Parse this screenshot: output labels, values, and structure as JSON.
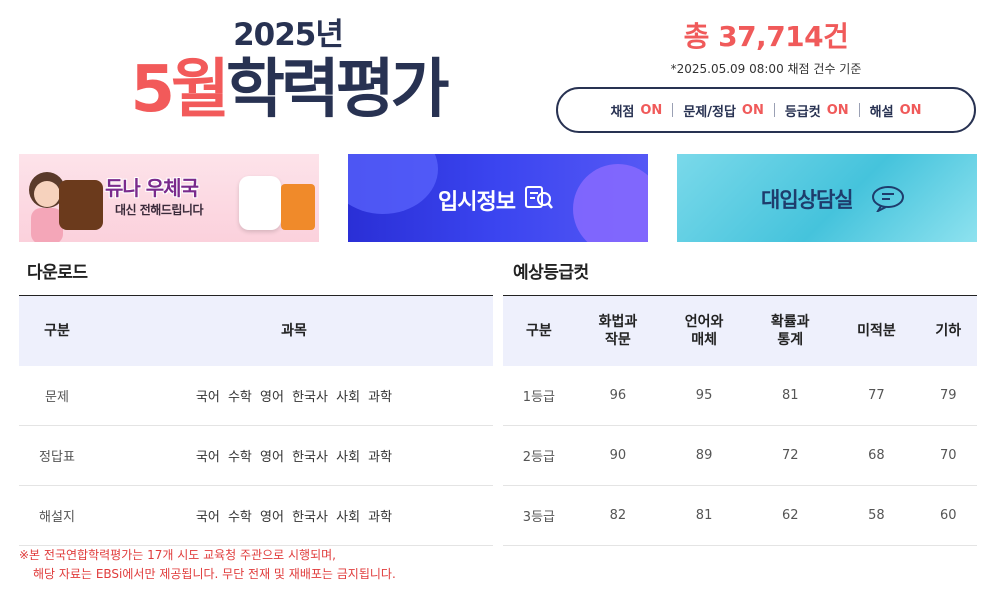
{
  "title": {
    "year": "2025년",
    "month": "5월",
    "rest": "학력평가"
  },
  "count": {
    "total": "총 37,714건",
    "note": "*2025.05.09 08:00 채점 건수 기준"
  },
  "status": [
    {
      "label": "채점",
      "value": "ON"
    },
    {
      "label": "문제/정답",
      "value": "ON"
    },
    {
      "label": "등급컷",
      "value": "ON"
    },
    {
      "label": "해설",
      "value": "ON"
    }
  ],
  "banners": {
    "event": {
      "title": "듀나 우체국",
      "subtitle": "대신 전해드립니다"
    },
    "admission": {
      "title": "입시정보"
    },
    "counsel": {
      "title": "대입상담실"
    }
  },
  "download": {
    "heading": "다운로드",
    "headers": [
      "구분",
      "과목"
    ],
    "rows": [
      {
        "type": "문제",
        "subjects": [
          "국어",
          "수학",
          "영어",
          "한국사",
          "사회",
          "과학"
        ]
      },
      {
        "type": "정답표",
        "subjects": [
          "국어",
          "수학",
          "영어",
          "한국사",
          "사회",
          "과학"
        ]
      },
      {
        "type": "해설지",
        "subjects": [
          "국어",
          "수학",
          "영어",
          "한국사",
          "사회",
          "과학"
        ]
      }
    ]
  },
  "gradecut": {
    "heading": "예상등급컷",
    "headers": [
      {
        "line1": "구분",
        "line2": ""
      },
      {
        "line1": "화법과",
        "line2": "작문"
      },
      {
        "line1": "언어와",
        "line2": "매체"
      },
      {
        "line1": "확률과",
        "line2": "통계"
      },
      {
        "line1": "미적분",
        "line2": ""
      },
      {
        "line1": "기하",
        "line2": ""
      }
    ],
    "rows": [
      {
        "grade": "1등급",
        "values": [
          "96",
          "95",
          "81",
          "77",
          "79"
        ]
      },
      {
        "grade": "2등급",
        "values": [
          "90",
          "89",
          "72",
          "68",
          "70"
        ]
      },
      {
        "grade": "3등급",
        "values": [
          "82",
          "81",
          "62",
          "58",
          "60"
        ]
      }
    ]
  },
  "footnote": {
    "line1": "※본 전국연합학력평가는 17개 시도 교육청 주관으로 시행되며,",
    "line2": "해당 자료는 EBSi에서만 제공됩니다. 무단 전재 및 재배포는 금지됩니다."
  },
  "colors": {
    "navy": "#283252",
    "accent": "#f05a5a",
    "header_bg": "#eef0fc"
  }
}
